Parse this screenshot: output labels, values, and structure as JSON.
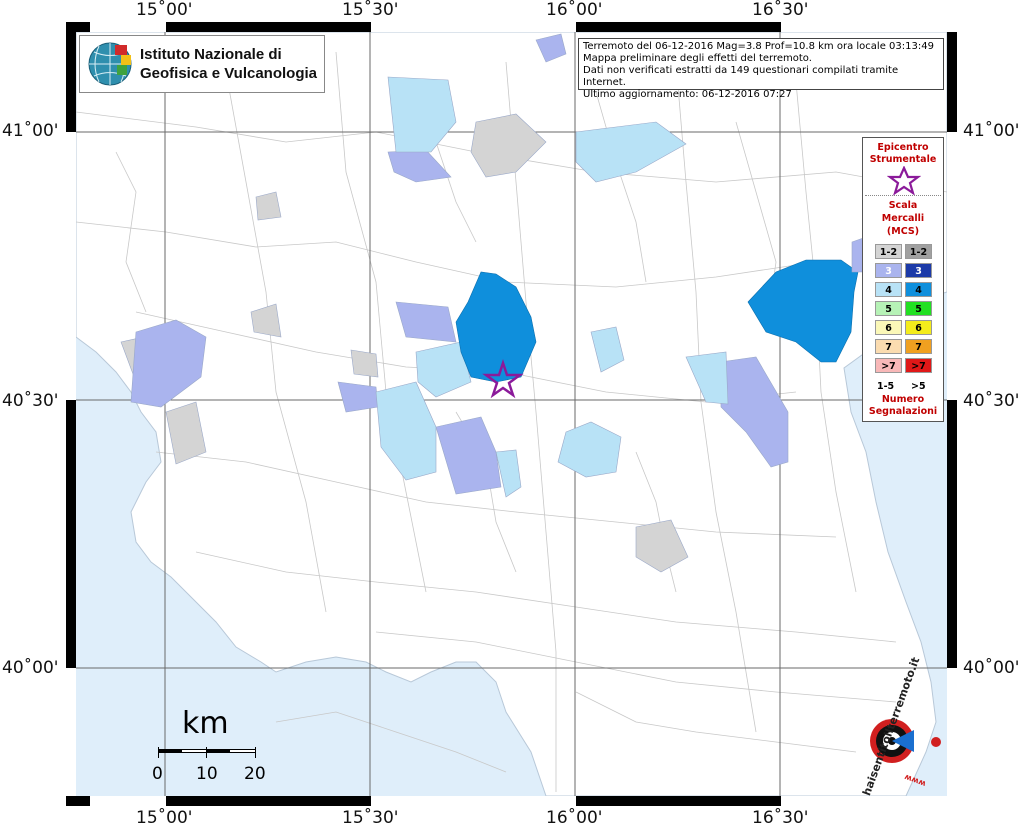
{
  "axes": {
    "top_lon_labels": [
      "15˚00'",
      "15˚30'",
      "16˚00'",
      "16˚30'"
    ],
    "bottom_lon_labels": [
      "15˚00'",
      "15˚30'",
      "16˚00'",
      "16˚30'"
    ],
    "left_lat_labels": [
      "41˚00'",
      "40˚30'",
      "40˚00'"
    ],
    "right_lat_labels": [
      "41˚00'",
      "40˚30'",
      "40˚00'"
    ]
  },
  "institute": {
    "line1": "Istituto Nazionale di",
    "line2": "Geofisica e Vulcanologia"
  },
  "info": {
    "line1": "Terremoto del 06-12-2016 Mag=3.8 Prof=10.8 km ora locale 03:13:49",
    "line2": "Mappa preliminare degli effetti del terremoto.",
    "line3": "Dati non verificati estratti da 149 questionari compilati tramite Internet.",
    "line4": "Ultimo aggiornamento: 06-12-2016 07:27"
  },
  "legend": {
    "epicenter_line1": "Epicentro",
    "epicenter_line2": "Strumentale",
    "scale_line1": "Scala",
    "scale_line2": "Mercalli",
    "scale_line3": "(MCS)",
    "rows": [
      {
        "left": "1-2",
        "right": "1-2",
        "left_color": "#d4d4d4",
        "right_color": "#a0a0a0",
        "right_text": "#000000"
      },
      {
        "left": "3",
        "right": "3",
        "left_color": "#aab4ee",
        "right_color": "#1c3aa8",
        "right_text": "#ffffff"
      },
      {
        "left": "4",
        "right": "4",
        "left_color": "#b8e2f6",
        "right_color": "#0f8fdc",
        "right_text": "#000000"
      },
      {
        "left": "5",
        "right": "5",
        "left_color": "#b6f2b6",
        "right_color": "#22e022",
        "right_text": "#000000"
      },
      {
        "left": "6",
        "right": "6",
        "left_color": "#fbf8b8",
        "right_color": "#f4ec1c",
        "right_text": "#000000"
      },
      {
        "left": "7",
        "right": "7",
        "left_color": "#fbdcb0",
        "right_color": "#f0a020",
        "right_text": "#000000"
      },
      {
        "left": ">7",
        "right": ">7",
        "left_color": "#f8b8b8",
        "right_color": "#e01818",
        "right_text": "#000000"
      }
    ],
    "count_left": "1-5",
    "count_right": ">5",
    "count_line1": "Numero",
    "count_line2": "Segnalazioni"
  },
  "scalebar": {
    "unit": "km",
    "ticks": [
      "0",
      "10",
      "20"
    ]
  },
  "badge": {
    "text": "haisentitoilterremoto.it",
    "sub": "www"
  },
  "colors": {
    "sea": "#dfeefa",
    "land": "#ffffff",
    "grid": "#6a6a6a",
    "mcs3": "#aab4ee",
    "mcs4_light": "#b8e2f6",
    "mcs4_strong": "#0f8fdc",
    "mcs12": "#d4d4d4",
    "epicenter": "#8b1a9a"
  }
}
